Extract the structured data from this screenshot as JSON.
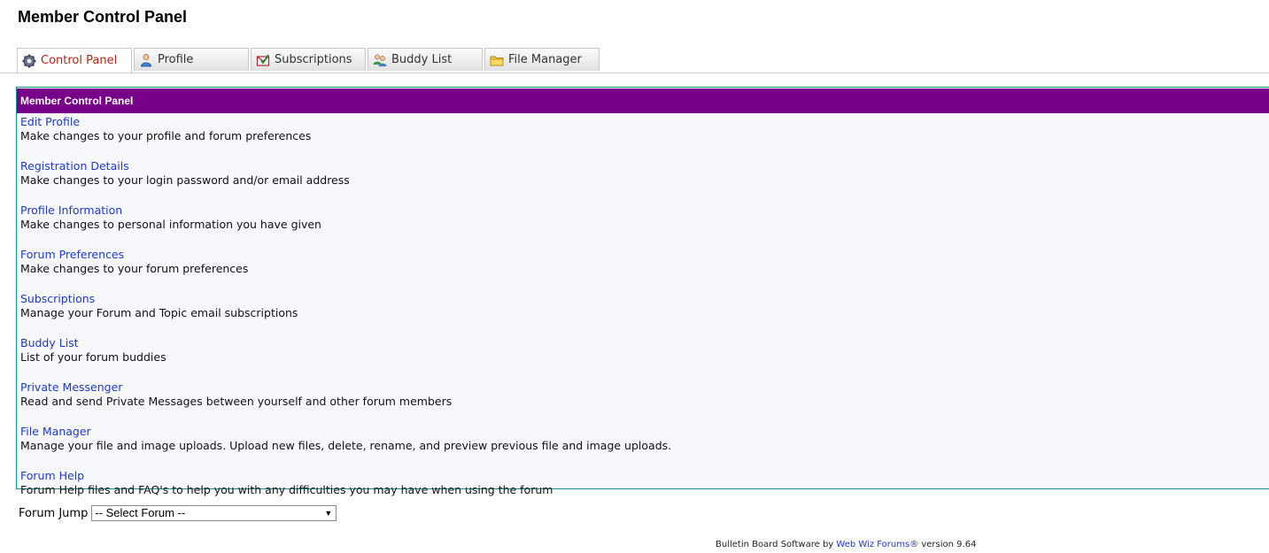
{
  "page": {
    "title": "Member Control Panel"
  },
  "tabs": [
    {
      "label": "Control Panel",
      "icon": "gear-icon",
      "active": true
    },
    {
      "label": "Profile",
      "icon": "user-icon",
      "active": false
    },
    {
      "label": "Subscriptions",
      "icon": "subscriptions-icon",
      "active": false
    },
    {
      "label": "Buddy List",
      "icon": "buddies-icon",
      "active": false
    },
    {
      "label": "File Manager",
      "icon": "folder-icon",
      "active": false
    }
  ],
  "panel": {
    "header": "Member Control Panel",
    "items": [
      {
        "link": "Edit Profile",
        "desc": "Make changes to your profile and forum preferences"
      },
      {
        "link": "Registration Details",
        "desc": "Make changes to your login password and/or email address"
      },
      {
        "link": "Profile Information",
        "desc": "Make changes to personal information you have given"
      },
      {
        "link": "Forum Preferences",
        "desc": "Make changes to your forum preferences"
      },
      {
        "link": "Subscriptions",
        "desc": "Manage your Forum and Topic email subscriptions"
      },
      {
        "link": "Buddy List",
        "desc": "List of your forum buddies"
      },
      {
        "link": "Private Messenger",
        "desc": "Read and send Private Messages between yourself and other forum members"
      },
      {
        "link": "File Manager",
        "desc": "Manage your file and image uploads. Upload new files, delete, rename, and preview previous file and image uploads."
      },
      {
        "link": "Forum Help",
        "desc": "Forum Help files and FAQ's to help you with any difficulties you may have when using the forum"
      }
    ]
  },
  "forum_jump": {
    "label": "Forum Jump",
    "selected": "-- Select Forum --"
  },
  "footer": {
    "prefix": "Bulletin Board Software by ",
    "link": "Web Wiz Forums®",
    "suffix": " version 9.64"
  },
  "colors": {
    "header_bg": "#770088",
    "link": "#1f3ac4",
    "active_tab_text": "#b1241a",
    "panel_border": "#1a8f8f"
  }
}
